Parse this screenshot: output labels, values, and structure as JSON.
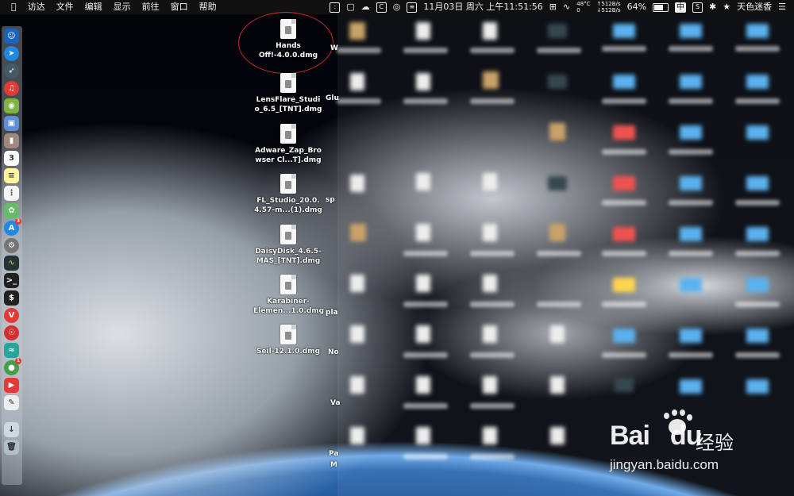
{
  "menubar": {
    "apple": "",
    "items": [
      "访达",
      "文件",
      "编辑",
      "显示",
      "前往",
      "窗口",
      "帮助"
    ],
    "status": {
      "temp": "48°C",
      "temp_sub": "0",
      "net_up": "↑512B/s",
      "net_down": "↓512B/s",
      "battery": "64%",
      "ime": "中",
      "datetime": "11月03日 周六 上午11:51:56",
      "user": "天色迷香"
    }
  },
  "desktop": {
    "files": [
      {
        "name": "Hands\nOff!-4.0.0.dmg"
      },
      {
        "name": "LensFlare_Studi\no_6.5_[TNT].dmg"
      },
      {
        "name": "Adware_Zap_Bro\nwser Cl...T].dmg"
      },
      {
        "name": "FL_Studio_20.0.\n4.57-m...(1).dmg"
      },
      {
        "name": "DaisyDisk_4.6.5-\nMAS_[TNT].dmg"
      },
      {
        "name": "Karabiner-\nElemen...1.0.dmg"
      },
      {
        "name": "Seil-12.1.0.dmg"
      }
    ],
    "cut_labels": [
      "W",
      "Glu",
      "sp",
      "pla",
      "No",
      "Va",
      "Pa",
      "M"
    ]
  },
  "watermark": {
    "brand": "Bai",
    "brand_suffix": "du",
    "cn": "经验",
    "url": "jingyan.baidu.com"
  },
  "colors": {
    "highlight": "#c62828",
    "folder": "#5ab1ee"
  }
}
